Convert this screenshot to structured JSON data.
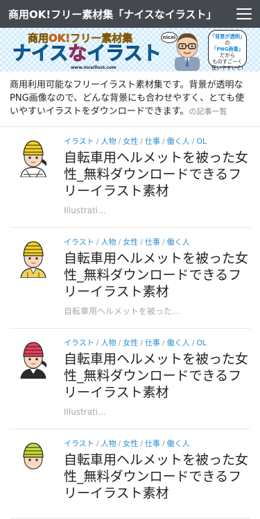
{
  "header": {
    "site_title": "商用OK!フリー素材集「ナイスなイラスト」"
  },
  "banner": {
    "tagline_part1": "商用OK!",
    "tagline_part2": "フリー素材集",
    "logo_word": "nicei",
    "main_title_a": "ナイス",
    "main_title_b": "な",
    "main_title_c": "イラスト",
    "url": "www.niceillust.com",
    "bubble_line1": "「背景が透明」",
    "bubble_line2": "の",
    "bubble_line3": "「PNG画像」",
    "bubble_line4": "だから",
    "bubble_line5": "ものすごーく",
    "bubble_line6": "使いやすいぞ!"
  },
  "intro": {
    "text": "商用利用可能なフリーイラスト素材集です。背景が透明なPNG画像なので、どんな背景にも合わせやすく、とても使いやすいイラストをダウンロードできます。",
    "suffix": "の記事一覧"
  },
  "items": [
    {
      "categories": [
        "イラスト",
        "人物",
        "女性",
        "仕事",
        "働く人",
        "OL"
      ],
      "title": "自転車用ヘルメットを被った女性_無料ダウンロードできるフリーイラスト素材",
      "excerpt": "Illustrati..."
    },
    {
      "categories": [
        "イラスト",
        "人物",
        "女性",
        "仕事",
        "働く人"
      ],
      "title": "自転車用ヘルメットを被った女性_無料ダウンロードできるフリーイラスト素材",
      "excerpt": "自転車用ヘルメットを被った..."
    },
    {
      "categories": [
        "イラスト",
        "人物",
        "女性",
        "仕事",
        "働く人",
        "OL"
      ],
      "title": "自転車用ヘルメットを被った女性_無料ダウンロードできるフリーイラスト素材",
      "excerpt": "Illustrati..."
    },
    {
      "categories": [
        "イラスト",
        "人物",
        "女性",
        "仕事",
        "働く人"
      ],
      "title": "自転車用ヘルメットを被った女性_無料ダウンロードできるフリーイラスト素材",
      "excerpt": ""
    }
  ],
  "colors": {
    "header_bg": "#444950",
    "category_link": "#2b8fd6",
    "helmet_yellow": "#f4d21c",
    "helmet_pink": "#e8425e",
    "helmet_lime": "#c8dc3a"
  },
  "icons": {
    "menu": "hamburger-icon"
  }
}
